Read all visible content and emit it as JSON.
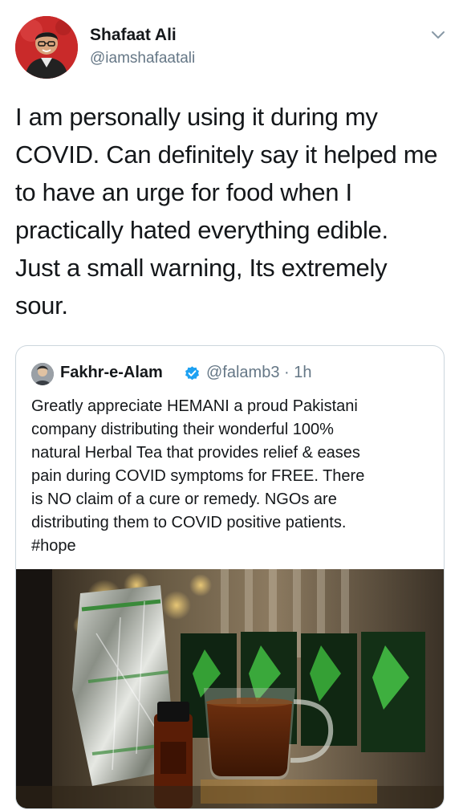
{
  "tweet": {
    "author_name": "Shafaat Ali",
    "author_handle": "@iamshafaatali",
    "text": "I am personally using it during my\nCOVID. Can definitely say it helped me\nto have an urge for food when I\npractically hated everything edible.\nJust a small warning, Its extremely\nsour."
  },
  "quoted": {
    "author_name": "Fakhr-e-Alam",
    "verified": true,
    "handle_time": "@falamb3 · 1h",
    "text": "Greatly appreciate HEMANI a proud Pakistani\ncompany distributing their wonderful 100%\nnatural Herbal Tea that provides relief & eases\npain during COVID symptoms for FREE. There\nis NO claim of a cure or remedy. NGOs are\ndistributing them to COVID positive patients.\n#hope",
    "image_alt": "Herbal tea packets, a small bottle and a glass cup of tea"
  },
  "icons": {
    "chevron": "chevron-down-icon",
    "verified": "verified-badge-icon"
  },
  "colors": {
    "text": "#14171a",
    "secondary": "#657786",
    "verified": "#1da1f2",
    "border": "#ccd6dd"
  }
}
